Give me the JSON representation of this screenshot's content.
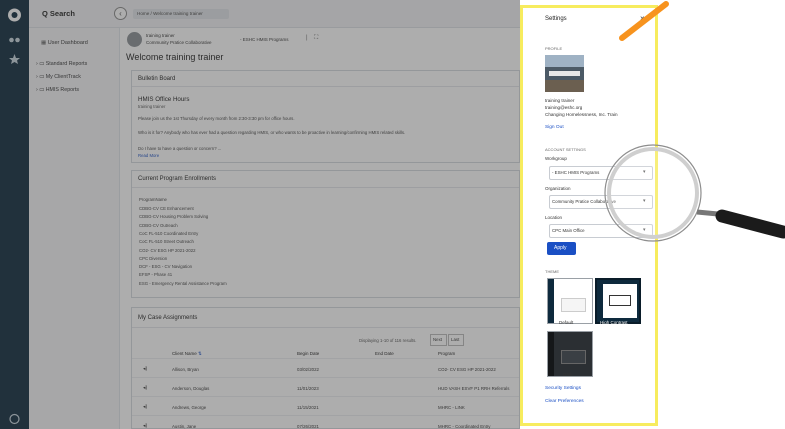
{
  "topbar": {
    "search_label": "Q  Search",
    "breadcrumb": "Home / Welcome training trainer"
  },
  "sidebar": {
    "user_dashboard": "User Dashboard",
    "items": [
      "Standard Reports",
      "My ClientTrack",
      "HMIS Reports"
    ]
  },
  "context": {
    "org_line1": "training trainer",
    "org_line2": "Community Pratice Collaborative",
    "program": "- ESHC HMIS Programs"
  },
  "page_title": "Welcome training trainer",
  "bulletin": {
    "title": "Bulletin Board",
    "heading": "HMIS Office Hours",
    "author": "training trainer",
    "body1": "Please join us the 1st Thursday of every month from 2:30-3:30 pm for office hours.",
    "body2": "Who is it for? Anybody who has ever had a question regarding HMIS, or who wants to be proactive in learning/confirming HMIS related skills.",
    "body3": "Do I have to have a question or concern? ...",
    "read_more": "Read More"
  },
  "enrollments": {
    "title": "Current Program Enrollments",
    "column": "ProgramName",
    "rows": [
      "CDBG-CV CE Enhancement",
      "CDBG-CV Housing Problem Solving",
      "CDBG-CV Outreach",
      "CoC FL-510 Coordinated Entry",
      "CoC FL-510 Street Outreach",
      "CO2- CV ESG HP 2021-2022",
      "CPC Diversion",
      "DCF - ESG - CV Navigation",
      "EFSP - Phase 41",
      "ESG - Emergency Rental Assistance Program"
    ]
  },
  "cases": {
    "title": "My Case Assignments",
    "pager": "Displaying 1-10 of 116 results.",
    "next_label": "Next",
    "last_label": "Last",
    "headers": [
      "Client Name",
      "Begin Date",
      "End Date",
      "Program"
    ],
    "rows": [
      [
        "Allison, Bryan",
        "03/02/2022",
        "",
        "CO2- CV ESG HP 2021-2022"
      ],
      [
        "Anderson, Douglas",
        "11/01/2023",
        "",
        "HUD VASH ESVF P1 RRH Referrals"
      ],
      [
        "Andrews, George",
        "11/15/2021",
        "",
        "MHRC - LINK"
      ],
      [
        "Austin, Jane",
        "07/26/2021",
        "",
        "MHRC - Coordinated Entry"
      ]
    ]
  },
  "settings": {
    "title": "Settings",
    "close": "×",
    "profile_section": "PROFILE",
    "profile_name": "training trainer",
    "profile_email": "training@eshc.org",
    "profile_company": "Changing Homelessness, Inc. Train",
    "sign_out": "Sign Out",
    "account_section": "ACCOUNT SETTINGS",
    "workgroup_label": "Workgroup",
    "workgroup_value": "- ESHC HMIS Programs",
    "org_label": "Organization",
    "org_value": "Community Pratice Collaborative",
    "location_label": "Location",
    "location_value": "CPC Main Office",
    "apply": "Apply",
    "theme_section": "THEME",
    "theme_default": "Default",
    "theme_high": "High Contrast",
    "theme_dark": "Dark",
    "security": "Security Settings",
    "clear": "Clear Preferences"
  },
  "colors": {
    "nav": "#0e2a3d",
    "accent": "#1a4fc4",
    "highlight": "#f7ec5e",
    "pen": "#f7931e"
  }
}
